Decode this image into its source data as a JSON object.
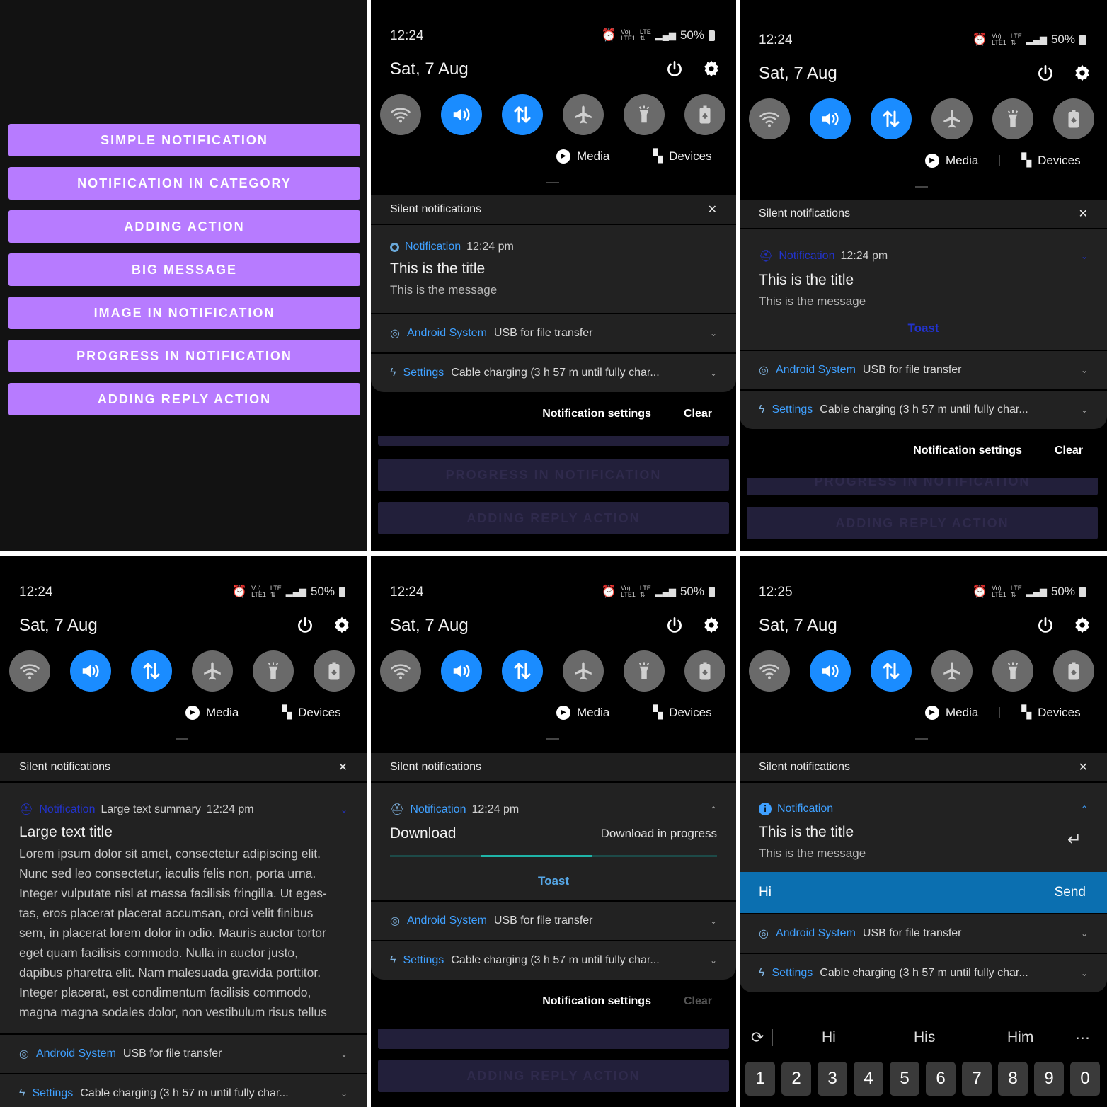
{
  "app": {
    "buttons": [
      "SIMPLE NOTIFICATION",
      "NOTIFICATION IN CATEGORY",
      "ADDING ACTION",
      "BIG MESSAGE",
      "IMAGE IN NOTIFICATION",
      "PROGRESS IN NOTIFICATION",
      "ADDING REPLY ACTION"
    ]
  },
  "status": {
    "time_a": "12:24",
    "time_b": "12:25",
    "battery": "50%",
    "date": "Sat, 7 Aug",
    "vol": "Vo)",
    "lte": "LTE",
    "lte1": "LTE1",
    "arrows": "⇅"
  },
  "quick": {
    "media": "Media",
    "devices": "Devices"
  },
  "panel": {
    "silent": "Silent notifications",
    "close": "✕",
    "app_notification": "Notification",
    "time": "12:24 pm",
    "title": "This is the title",
    "message": "This is the message",
    "toast": "Toast",
    "android_system": "Android System",
    "usb": "USB for file transfer",
    "settings_app": "Settings",
    "charging": "Cable charging (3 h 57 m until fully char...",
    "notif_settings": "Notification settings",
    "clear": "Clear",
    "bg_progress": "PROGRESS IN NOTIFICATION",
    "bg_reply": "ADDING REPLY ACTION"
  },
  "big": {
    "summary": "Large text summary",
    "title": "Large text title",
    "lines": [
      "Lorem ipsum dolor sit amet, consectetur adipiscing elit.",
      "Nunc sed leo consectetur, iaculis felis non, porta urna.",
      "Integer vulputate nisl at massa facilisis fringilla. Ut eges-",
      "tas, eros placerat placerat accumsan, orci velit finibus",
      "sem, in placerat lorem dolor in odio. Mauris auctor tortor",
      "eget quam facilisis commodo. Nulla in auctor justo,",
      "dapibus pharetra elit. Nam malesuada gravida porttitor.",
      "Integer placerat, est condimentum facilisis commodo,",
      "magna magna sodales dolor, non vestibulum risus tellus"
    ]
  },
  "progress": {
    "title": "Download",
    "status": "Download in progress",
    "value": 0.56
  },
  "reply": {
    "text": "Hi",
    "send": "Send",
    "suggestions": [
      "Hi",
      "His",
      "Him"
    ],
    "more": "⋯",
    "keys": [
      "1",
      "2",
      "3",
      "4",
      "5",
      "6",
      "7",
      "8",
      "9",
      "0"
    ]
  }
}
